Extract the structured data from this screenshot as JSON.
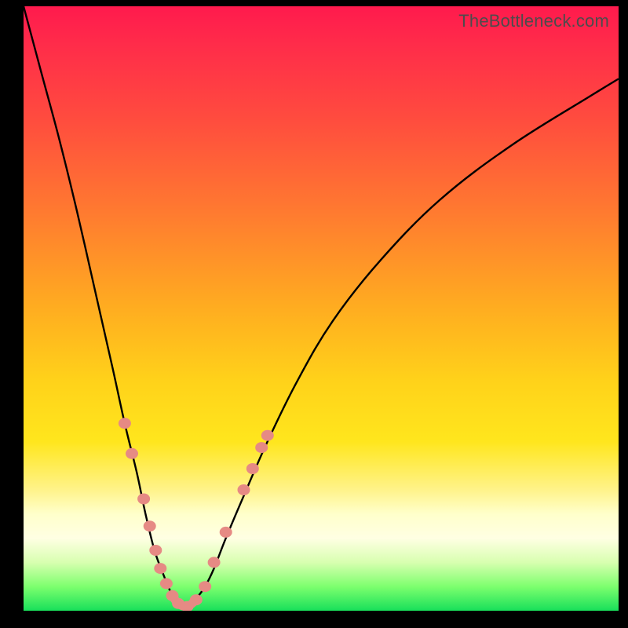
{
  "watermark": "TheBottleneck.com",
  "colors": {
    "background": "#000000",
    "curve": "#000000",
    "marker": "#e68a84",
    "gradient_top": "#ff1a4d",
    "gradient_bottom": "#18e05a"
  },
  "chart_data": {
    "type": "line",
    "title": "",
    "xlabel": "",
    "ylabel": "",
    "xlim": [
      0,
      100
    ],
    "ylim": [
      0,
      100
    ],
    "series": [
      {
        "name": "left-curve",
        "x": [
          0,
          3,
          6,
          9,
          12,
          15,
          17,
          19,
          20.5,
          22,
          23.5,
          25,
          26,
          27
        ],
        "y": [
          100,
          89,
          78,
          66,
          53,
          40,
          31,
          23,
          16,
          10,
          6,
          2.5,
          1,
          0.5
        ]
      },
      {
        "name": "right-curve",
        "x": [
          27,
          28,
          29,
          30.5,
          32,
          34,
          37,
          41,
          46,
          52,
          60,
          70,
          82,
          95,
          100
        ],
        "y": [
          0.5,
          1,
          2,
          4,
          7,
          12,
          19,
          28,
          38,
          48,
          58,
          68,
          77,
          85,
          88
        ]
      }
    ],
    "markers": {
      "name": "highlight-points",
      "points": [
        {
          "x": 17.0,
          "y": 31.0
        },
        {
          "x": 18.2,
          "y": 26.0
        },
        {
          "x": 20.2,
          "y": 18.5
        },
        {
          "x": 21.2,
          "y": 14.0
        },
        {
          "x": 22.2,
          "y": 10.0
        },
        {
          "x": 23.0,
          "y": 7.0
        },
        {
          "x": 24.0,
          "y": 4.5
        },
        {
          "x": 25.0,
          "y": 2.5
        },
        {
          "x": 26.0,
          "y": 1.2
        },
        {
          "x": 27.5,
          "y": 0.7
        },
        {
          "x": 29.0,
          "y": 1.8
        },
        {
          "x": 30.5,
          "y": 4.0
        },
        {
          "x": 32.0,
          "y": 8.0
        },
        {
          "x": 34.0,
          "y": 13.0
        },
        {
          "x": 37.0,
          "y": 20.0
        },
        {
          "x": 38.5,
          "y": 23.5
        },
        {
          "x": 40.0,
          "y": 27.0
        },
        {
          "x": 41.0,
          "y": 29.0
        }
      ]
    }
  }
}
